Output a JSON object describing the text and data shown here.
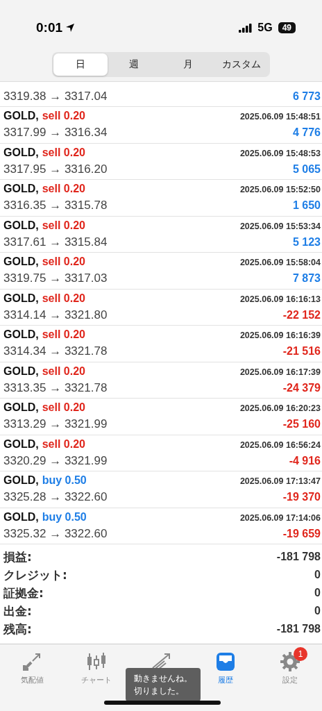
{
  "status_bar": {
    "time": "0:01",
    "network": "5G",
    "battery": "49"
  },
  "period_tabs": [
    {
      "label": "日",
      "selected": true
    },
    {
      "label": "週",
      "selected": false
    },
    {
      "label": "月",
      "selected": false
    },
    {
      "label": "カスタム",
      "selected": false
    }
  ],
  "deals": [
    {
      "prices": "3319.38 → 3317.04",
      "profit": "6 773",
      "loss": false
    },
    {
      "symbol": "GOLD,",
      "order": "sell 0.20",
      "kind": "sell",
      "time": "2025.06.09 15:48:51",
      "prices": "3317.99 → 3316.34",
      "profit": "4 776",
      "loss": false
    },
    {
      "symbol": "GOLD,",
      "order": "sell 0.20",
      "kind": "sell",
      "time": "2025.06.09 15:48:53",
      "prices": "3317.95 → 3316.20",
      "profit": "5 065",
      "loss": false
    },
    {
      "symbol": "GOLD,",
      "order": "sell 0.20",
      "kind": "sell",
      "time": "2025.06.09 15:52:50",
      "prices": "3316.35 → 3315.78",
      "profit": "1 650",
      "loss": false
    },
    {
      "symbol": "GOLD,",
      "order": "sell 0.20",
      "kind": "sell",
      "time": "2025.06.09 15:53:34",
      "prices": "3317.61 → 3315.84",
      "profit": "5 123",
      "loss": false
    },
    {
      "symbol": "GOLD,",
      "order": "sell 0.20",
      "kind": "sell",
      "time": "2025.06.09 15:58:04",
      "prices": "3319.75 → 3317.03",
      "profit": "7 873",
      "loss": false
    },
    {
      "symbol": "GOLD,",
      "order": "sell 0.20",
      "kind": "sell",
      "time": "2025.06.09 16:16:13",
      "prices": "3314.14 → 3321.80",
      "profit": "-22 152",
      "loss": true
    },
    {
      "symbol": "GOLD,",
      "order": "sell 0.20",
      "kind": "sell",
      "time": "2025.06.09 16:16:39",
      "prices": "3314.34 → 3321.78",
      "profit": "-21 516",
      "loss": true
    },
    {
      "symbol": "GOLD,",
      "order": "sell 0.20",
      "kind": "sell",
      "time": "2025.06.09 16:17:39",
      "prices": "3313.35 → 3321.78",
      "profit": "-24 379",
      "loss": true
    },
    {
      "symbol": "GOLD,",
      "order": "sell 0.20",
      "kind": "sell",
      "time": "2025.06.09 16:20:23",
      "prices": "3313.29 → 3321.99",
      "profit": "-25 160",
      "loss": true
    },
    {
      "symbol": "GOLD,",
      "order": "sell 0.20",
      "kind": "sell",
      "time": "2025.06.09 16:56:24",
      "prices": "3320.29 → 3321.99",
      "profit": "-4 916",
      "loss": true
    },
    {
      "symbol": "GOLD,",
      "order": "buy 0.50",
      "kind": "buy",
      "time": "2025.06.09 17:13:47",
      "prices": "3325.28 → 3322.60",
      "profit": "-19 370",
      "loss": true
    },
    {
      "symbol": "GOLD,",
      "order": "buy 0.50",
      "kind": "buy",
      "time": "2025.06.09 17:14:06",
      "prices": "3325.32 → 3322.60",
      "profit": "-19 659",
      "loss": true
    }
  ],
  "summary": [
    {
      "label": "損益:",
      "value": "-181 798"
    },
    {
      "label": "クレジット:",
      "value": "0"
    },
    {
      "label": "証拠金:",
      "value": "0"
    },
    {
      "label": "出金:",
      "value": "0"
    },
    {
      "label": "残高:",
      "value": "-181 798"
    }
  ],
  "tab_bar": [
    {
      "kind": "quotes",
      "label": "気配値",
      "selected": false
    },
    {
      "kind": "chart",
      "label": "チャート",
      "selected": false
    },
    {
      "kind": "trade",
      "selected": false
    },
    {
      "kind": "history",
      "label": "履歴",
      "selected": true
    },
    {
      "kind": "settings",
      "label": "設定",
      "selected": false,
      "badge": "1"
    }
  ],
  "caption": [
    "動きませんね。",
    "切りました。"
  ]
}
